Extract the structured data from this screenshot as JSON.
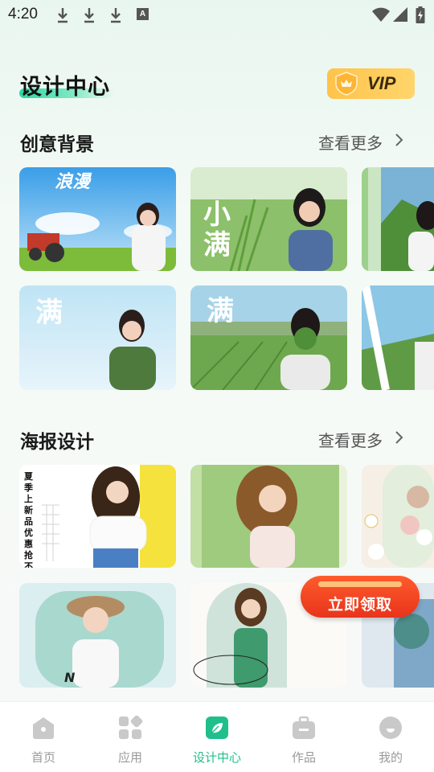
{
  "status_bar": {
    "time": "4:20",
    "icons": [
      "download-icon",
      "download-icon",
      "download-icon",
      "a-icon",
      "wifi-icon",
      "signal-icon",
      "battery-charging-icon"
    ]
  },
  "header": {
    "title": "设计中心",
    "vip_label": "VIP"
  },
  "sections": {
    "creative": {
      "title": "创意背景",
      "more": "查看更多"
    },
    "poster": {
      "title": "海报设计",
      "more": "查看更多"
    }
  },
  "card_text": {
    "c1": "浪漫",
    "c2": "小满",
    "c4": "满",
    "c5": "满",
    "p1": "夏季上新品优惠抢不停",
    "p4": "N"
  },
  "promo": {
    "label": "立即领取"
  },
  "tabs": [
    {
      "label": "首页",
      "icon": "home-icon",
      "active": false
    },
    {
      "label": "应用",
      "icon": "apps-icon",
      "active": false
    },
    {
      "label": "设计中心",
      "icon": "leaf-icon",
      "active": true
    },
    {
      "label": "作品",
      "icon": "briefcase-icon",
      "active": false
    },
    {
      "label": "我的",
      "icon": "profile-icon",
      "active": false
    }
  ],
  "colors": {
    "accent": "#1fbf8c",
    "vip": "#ffc34a",
    "promo": "#ff5b2c"
  }
}
